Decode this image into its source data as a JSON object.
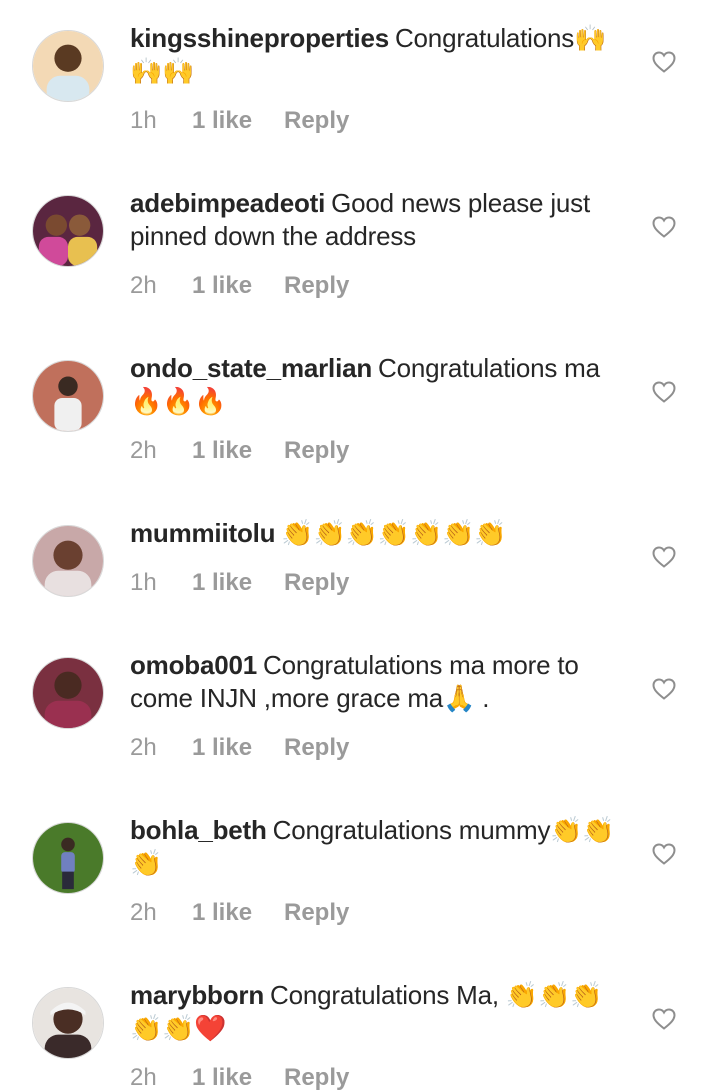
{
  "comments": [
    {
      "username": "kingsshineproperties",
      "text": "Congratulations🙌🙌🙌",
      "time": "1h",
      "likes": "1 like",
      "reply": "Reply",
      "avatar_color": "#f0c89a"
    },
    {
      "username": "adebimpeadeoti",
      "text": "Good news please just pinned down the address",
      "time": "2h",
      "likes": "1 like",
      "reply": "Reply",
      "avatar_color": "#6a2a4a"
    },
    {
      "username": "ondo_state_marlian",
      "text": "Congratulations ma🔥🔥🔥",
      "time": "2h",
      "likes": "1 like",
      "reply": "Reply",
      "avatar_color": "#c86a55"
    },
    {
      "username": "mummiitolu",
      "text": "👏👏👏👏👏👏👏",
      "time": "1h",
      "likes": "1 like",
      "reply": "Reply",
      "avatar_color": "#b98a86"
    },
    {
      "username": "omoba001",
      "text": "Congratulations ma more to come INJN ,more grace ma🙏 .",
      "time": "2h",
      "likes": "1 like",
      "reply": "Reply",
      "avatar_color": "#8a3a4a"
    },
    {
      "username": "bohla_beth",
      "text": "Congratulations mummy👏👏👏",
      "time": "2h",
      "likes": "1 like",
      "reply": "Reply",
      "avatar_color": "#4f7a2e"
    },
    {
      "username": "marybborn",
      "text": "Congratulations Ma, 👏👏👏👏👏❤️",
      "time": "2h",
      "likes": "1 like",
      "reply": "Reply",
      "avatar_color": "#6a4a3a"
    }
  ]
}
